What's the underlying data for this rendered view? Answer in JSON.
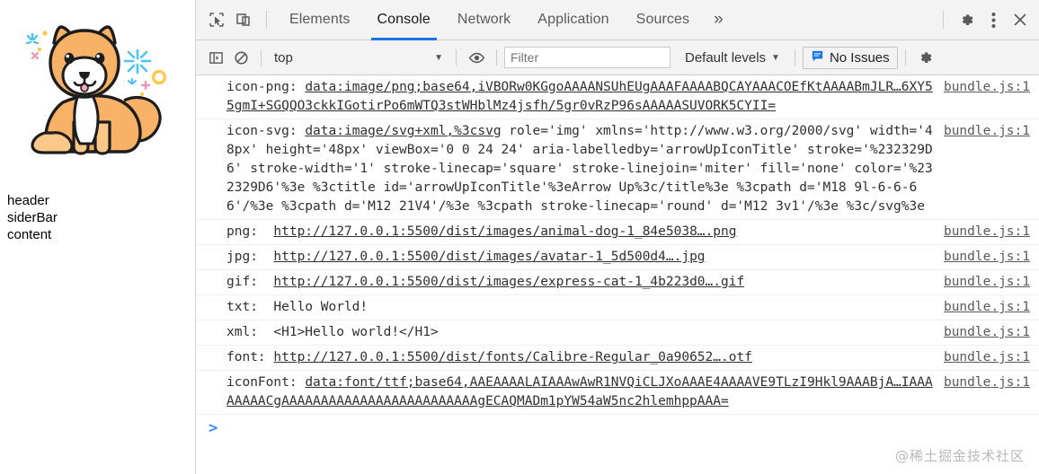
{
  "page": {
    "illustration": "shiba-dog-illustration",
    "labels": [
      "header",
      "siderBar",
      "content"
    ]
  },
  "devtools": {
    "toolbar": {
      "inspect_icon": "inspect-element-icon",
      "device_icon": "device-toolbar-icon",
      "tabs": [
        {
          "label": "Elements",
          "active": false
        },
        {
          "label": "Console",
          "active": true
        },
        {
          "label": "Network",
          "active": false
        },
        {
          "label": "Application",
          "active": false
        },
        {
          "label": "Sources",
          "active": false
        }
      ],
      "more_tabs": "»",
      "settings_icon": "gear-icon",
      "menu_icon": "kebab-menu-icon",
      "close_icon": "close-icon"
    },
    "filterbar": {
      "sidebar_icon": "show-console-sidebar-icon",
      "clear_icon": "clear-console-icon",
      "context": "top",
      "eye_icon": "live-expression-eye-icon",
      "filter_placeholder": "Filter",
      "filter_value": "",
      "levels": "Default levels",
      "issues_label": "No Issues",
      "issues_icon": "issues-bubble-icon",
      "settings_icon": "console-settings-gear-icon",
      "accent": "#1a73e8"
    },
    "logs": [
      {
        "label": "icon-png: ",
        "link": "data:image/png;base64,iVBORw0KGgoAAAANSUhEUgAAAFAAAABQCAYAAACOEfKtAAAABmJLR…6XY55gmI+SGQQO3ckkIGotirPo6mWTQ3stWHblMz4jsfh/5gr0vRzP96sAAAAASUVORK5CYII=",
        "source": "bundle.js:1"
      },
      {
        "label": "icon-svg: ",
        "link": "data:image/svg+xml,%3csvg",
        "rest": " role='img' xmlns='http://www.w3.org/2000/svg' width='48px' height='48px' viewBox='0 0 24 24' aria-labelledby='arrowUpIconTitle' stroke='%232329D6' stroke-width='1' stroke-linecap='square' stroke-linejoin='miter' fill='none' color='%232329D6'%3e %3ctitle id='arrowUpIconTitle'%3eArrow Up%3c/title%3e %3cpath d='M18 9l-6-6-6 6'/%3e %3cpath d='M12 21V4'/%3e %3cpath stroke-linecap='round' d='M12 3v1'/%3e %3c/svg%3e",
        "link_tail": "http://www.w3.org/2000/svg",
        "source": "bundle.js:1"
      },
      {
        "label": "png:  ",
        "link": "http://127.0.0.1:5500/dist/images/animal-dog-1_84e5038….png",
        "source": "bundle.js:1"
      },
      {
        "label": "jpg:  ",
        "link": "http://127.0.0.1:5500/dist/images/avatar-1_5d500d4….jpg",
        "source": "bundle.js:1"
      },
      {
        "label": "gif:  ",
        "link": "http://127.0.0.1:5500/dist/images/express-cat-1_4b223d0….gif",
        "source": "bundle.js:1"
      },
      {
        "label": "txt:  Hello World!",
        "source": "bundle.js:1"
      },
      {
        "label": "xml:  <H1>Hello world!</H1>",
        "source": "bundle.js:1"
      },
      {
        "label": "font: ",
        "link": "http://127.0.0.1:5500/dist/fonts/Calibre-Regular_0a90652….otf",
        "source": "bundle.js:1"
      },
      {
        "label": "iconFont: ",
        "link": "data:font/ttf;base64,AAEAAAALAIAAAwAwR1NVQiCLJXoAAAE4AAAAVE9TLzI9Hkl9AAABjA…IAAAAAAAACgAAAAAAAAAAAAAAAAAAAAAAAAAgECAQMADm1pYW54aW5nc2hlemhppAAA=",
        "source": "bundle.js:1"
      }
    ],
    "prompt_caret": ">"
  },
  "watermark": "@稀土掘金技术社区"
}
